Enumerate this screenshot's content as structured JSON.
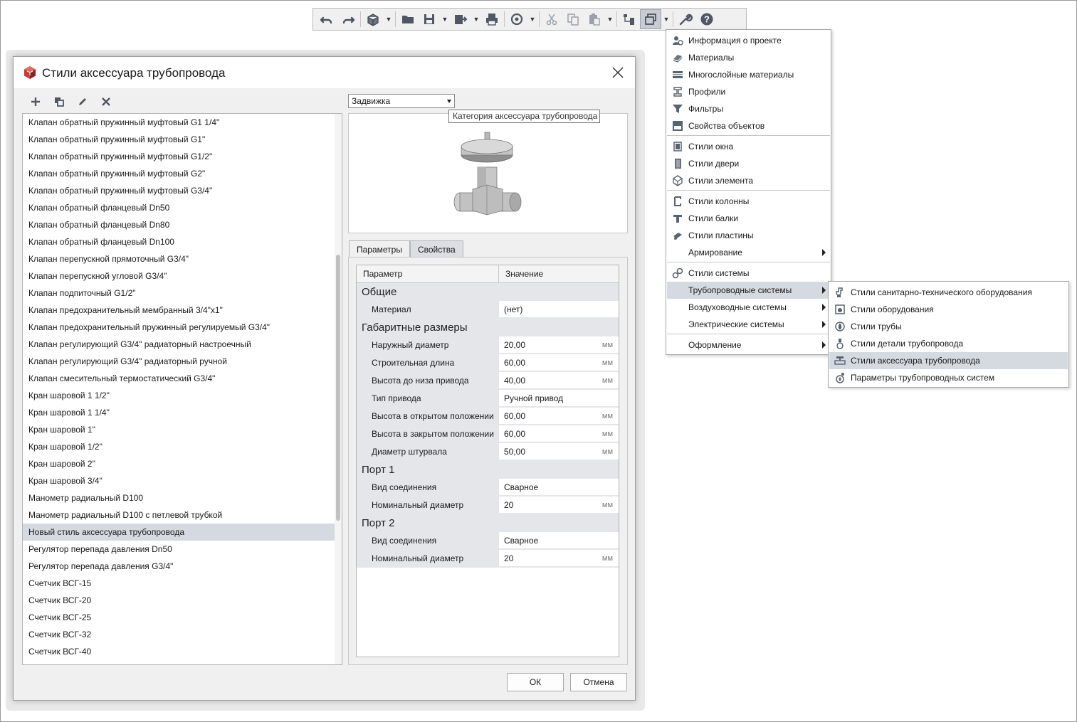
{
  "toolbar": {
    "buttons": [
      "undo-icon",
      "redo-icon",
      "3d-view-icon",
      "open-folder-icon",
      "save-icon",
      "export-icon",
      "print-icon",
      "sync-icon",
      "cut-icon",
      "copy-icon",
      "paste-icon",
      "structure-icon",
      "styles-icon",
      "wrench-icon",
      "help-icon"
    ],
    "help_glyph": "?"
  },
  "menu": {
    "items": [
      {
        "label": "Информация о проекте",
        "icon": "project-info-icon"
      },
      {
        "label": "Материалы",
        "icon": "materials-icon"
      },
      {
        "label": "Многослойные материалы",
        "icon": "multilayer-materials-icon"
      },
      {
        "label": "Профили",
        "icon": "profiles-icon"
      },
      {
        "label": "Фильтры",
        "icon": "filters-icon"
      },
      {
        "label": "Свойства объектов",
        "icon": "object-properties-icon"
      },
      {
        "label": "Стили окна",
        "icon": "window-styles-icon"
      },
      {
        "label": "Стили двери",
        "icon": "door-styles-icon"
      },
      {
        "label": "Стили элемента",
        "icon": "element-styles-icon"
      },
      {
        "label": "Стили колонны",
        "icon": "column-styles-icon"
      },
      {
        "label": "Стили балки",
        "icon": "beam-styles-icon"
      },
      {
        "label": "Стили пластины",
        "icon": "plate-styles-icon"
      },
      {
        "label": "Армирование",
        "icon": ""
      },
      {
        "label": "Стили системы",
        "icon": "system-styles-icon"
      },
      {
        "label": "Трубопроводные системы",
        "icon": ""
      },
      {
        "label": "Воздуховодные системы",
        "icon": ""
      },
      {
        "label": "Электрические системы",
        "icon": ""
      },
      {
        "label": "Оформление",
        "icon": ""
      }
    ]
  },
  "submenu": {
    "items": [
      {
        "label": "Стили санитарно-технического оборудования",
        "icon": "sanitary-equipment-icon"
      },
      {
        "label": "Стили оборудования",
        "icon": "equipment-styles-icon"
      },
      {
        "label": "Стили трубы",
        "icon": "pipe-styles-icon"
      },
      {
        "label": "Стили детали трубопровода",
        "icon": "pipe-fitting-icon"
      },
      {
        "label": "Стили аксессуара трубопровода",
        "icon": "pipe-accessory-icon"
      },
      {
        "label": "Параметры трубопроводных систем",
        "icon": "pipe-system-params-icon"
      }
    ]
  },
  "dialog": {
    "title": "Стили аксессуара трубопровода",
    "combo_value": "Задвижка",
    "tooltip": "Категория аксессуара трубопровода",
    "list_items": [
      "Клапан обратный пружинный муфтовый G1 1/4\"",
      "Клапан обратный пружинный муфтовый G1\"",
      "Клапан обратный пружинный муфтовый G1/2\"",
      "Клапан обратный пружинный муфтовый G2\"",
      "Клапан обратный пружинный муфтовый G3/4\"",
      "Клапан обратный фланцевый Dn50",
      "Клапан обратный фланцевый Dn80",
      "Клапан обратный фланцевый Dn100",
      "Клапан перепускной прямоточный G3/4\"",
      "Клапан перепускной угловой  G3/4\"",
      "Клапан подпиточный G1/2\"",
      "Клапан предохранительный мембранный 3/4\"x1\"",
      "Клапан предохранительный пружинный регулируемый G3/4\"",
      "Клапан регулирующий G3/4\" радиаторный настроечный",
      "Клапан регулирующий G3/4\" радиаторный ручной",
      "Клапан смесительный термостатический G3/4\"",
      "Кран шаровой 1 1/2\"",
      "Кран шаровой 1 1/4\"",
      "Кран шаровой 1\"",
      "Кран шаровой 1/2\"",
      "Кран шаровой 2\"",
      "Кран шаровой 3/4\"",
      "Манометр радиальный D100",
      "Манометр радиальный D100 с петлевой трубкой",
      "Новый стиль аксессуара трубопровода",
      "Регулятор перепада давления Dn50",
      "Регулятор перепада давления G3/4\"",
      "Счетчик ВСГ-15",
      "Счетчик ВСГ-20",
      "Счетчик ВСГ-25",
      "Счетчик ВСГ-32",
      "Счетчик ВСГ-40"
    ],
    "tabs": [
      "Параметры",
      "Свойства"
    ],
    "grid_header": {
      "param": "Параметр",
      "value": "Значение"
    },
    "grid_rows": [
      {
        "type": "group",
        "label": "Общие"
      },
      {
        "type": "param",
        "label": "Материал",
        "value": "(нет)",
        "unit": ""
      },
      {
        "type": "group",
        "label": "Габаритные размеры"
      },
      {
        "type": "param",
        "label": "Наружный диаметр",
        "value": "20,00",
        "unit": "мм"
      },
      {
        "type": "param",
        "label": "Строительная длина",
        "value": "60,00",
        "unit": "мм"
      },
      {
        "type": "param",
        "label": "Высота до низа привода",
        "value": "40,00",
        "unit": "мм"
      },
      {
        "type": "param",
        "label": "Тип привода",
        "value": "Ручной привод",
        "unit": ""
      },
      {
        "type": "param",
        "label": "Высота в открытом положении",
        "value": "60,00",
        "unit": "мм"
      },
      {
        "type": "param",
        "label": "Высота в закрытом положении",
        "value": "60,00",
        "unit": "мм"
      },
      {
        "type": "param",
        "label": "Диаметр штурвала",
        "value": "50,00",
        "unit": "мм"
      },
      {
        "type": "group",
        "label": "Порт 1"
      },
      {
        "type": "param",
        "label": "Вид соединения",
        "value": "Сварное",
        "unit": ""
      },
      {
        "type": "param",
        "label": "Номинальный диаметр",
        "value": "20",
        "unit": "мм"
      },
      {
        "type": "group",
        "label": "Порт 2"
      },
      {
        "type": "param",
        "label": "Вид соединения",
        "value": "Сварное",
        "unit": ""
      },
      {
        "type": "param",
        "label": "Номинальный диаметр",
        "value": "20",
        "unit": "мм"
      }
    ],
    "ok_label": "ОК",
    "cancel_label": "Отмена"
  }
}
